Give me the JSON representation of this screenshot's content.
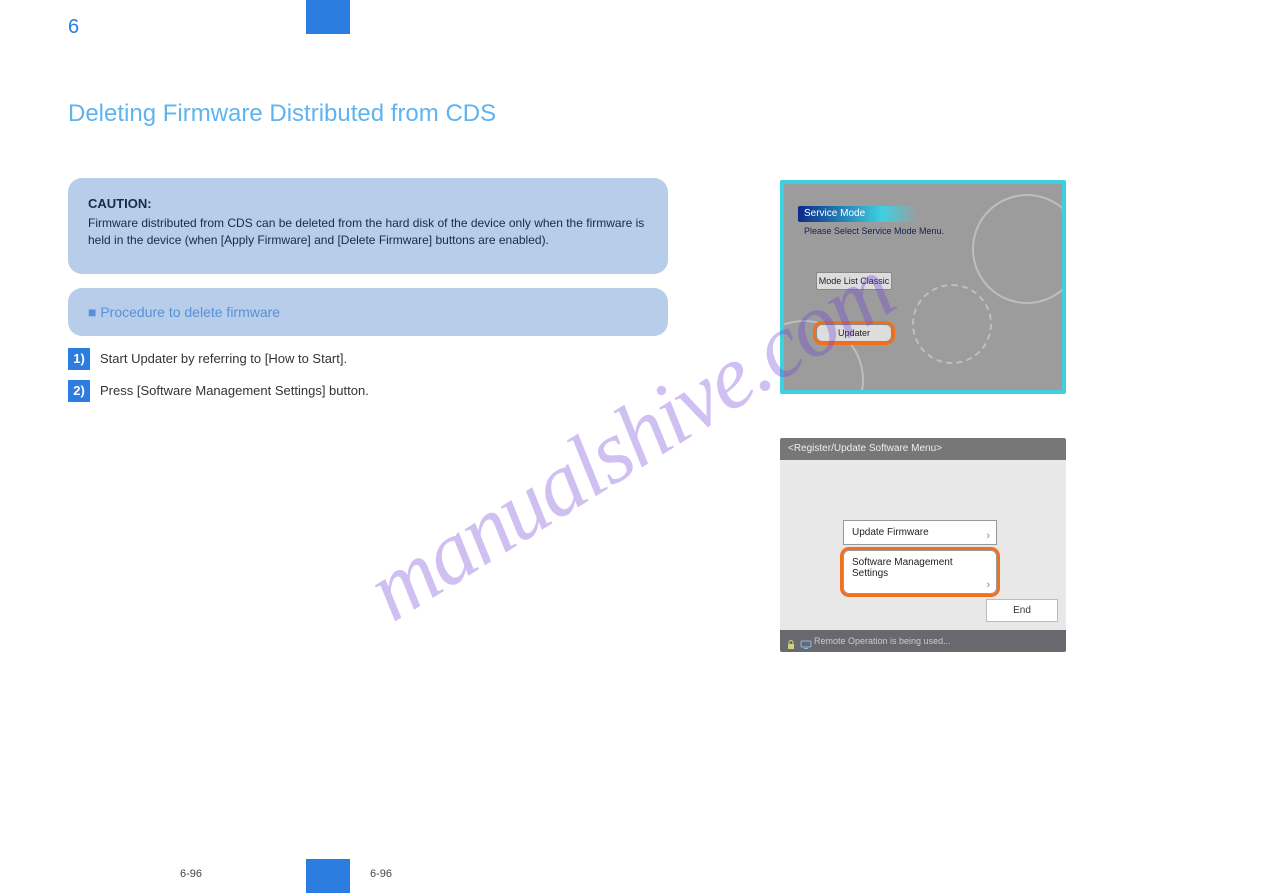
{
  "chapter": "6",
  "page_number": "6-96",
  "footer": "6-96",
  "heading": "Deleting Firmware Distributed from CDS",
  "caution": {
    "title": "CAUTION:",
    "body": "Firmware distributed from CDS can be deleted from the hard disk of the device only when the firmware is held in the device (when [Apply Firmware] and [Delete Firmware] buttons are enabled)."
  },
  "procedure_label": "■ Procedure to delete firmware",
  "steps": [
    "Start Updater by referring to [How to Start].",
    "Press [Software Management Settings] button."
  ],
  "fig1": {
    "window_title": "Service Mode",
    "subtitle": "Please Select Service Mode Menu.",
    "btn_classic": "Mode List Classic",
    "btn_updater": "Updater"
  },
  "fig2": {
    "window_title": "<Register/Update Software Menu>",
    "btn1": "Update Firmware",
    "btn2": "Software Management Settings",
    "end": "End",
    "status": "Remote Operation is being used..."
  },
  "watermark": "manualshive.com"
}
